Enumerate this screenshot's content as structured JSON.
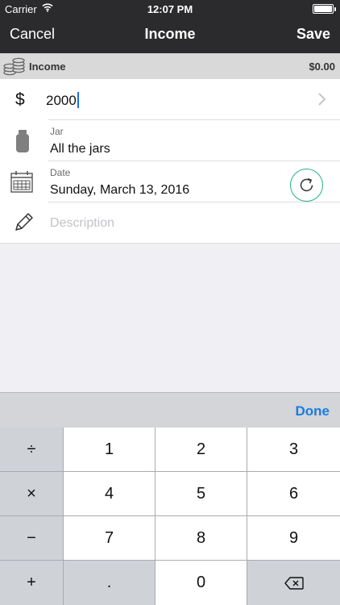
{
  "status_bar": {
    "carrier": "Carrier",
    "time": "12:07 PM"
  },
  "nav": {
    "cancel_label": "Cancel",
    "title": "Income",
    "save_label": "Save"
  },
  "section": {
    "title": "Income",
    "total": "$0.00"
  },
  "form": {
    "amount": {
      "currency_symbol": "$",
      "value": "2000"
    },
    "jar": {
      "label": "Jar",
      "value": "All the jars"
    },
    "date": {
      "label": "Date",
      "value": "Sunday, March 13, 2016"
    },
    "description": {
      "placeholder": "Description"
    }
  },
  "keyboard": {
    "done_label": "Done",
    "keys": {
      "divide": "÷",
      "multiply": "×",
      "minus": "−",
      "plus": "+",
      "k1": "1",
      "k2": "2",
      "k3": "3",
      "k4": "4",
      "k5": "5",
      "k6": "6",
      "k7": "7",
      "k8": "8",
      "k9": "9",
      "dot": ".",
      "k0": "0"
    }
  },
  "colors": {
    "nav_background": "#2b2b2d",
    "accent_blue": "#1a7ce0",
    "refresh_green": "#26b08c"
  },
  "icons": [
    "wifi-icon",
    "battery-icon",
    "coins-icon",
    "chevron-right-icon",
    "jar-icon",
    "calendar-icon",
    "refresh-icon",
    "pencil-icon",
    "backspace-icon"
  ]
}
